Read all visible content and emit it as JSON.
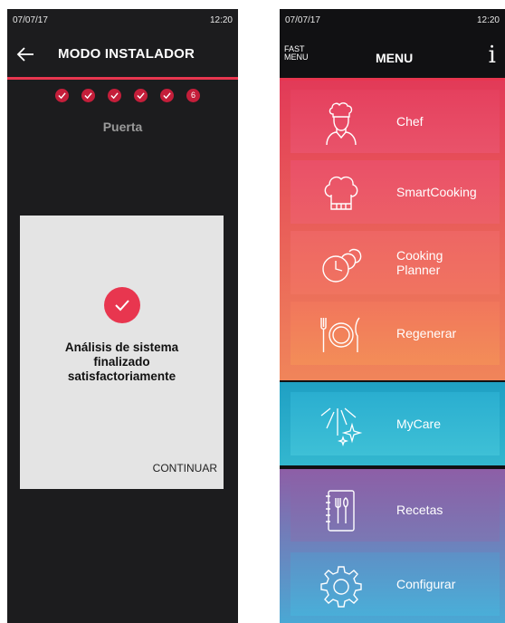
{
  "left": {
    "status": {
      "date": "07/07/17",
      "time": "12:20"
    },
    "header": {
      "title": "MODO INSTALADOR",
      "back_icon": "arrow-left-icon"
    },
    "steps": {
      "completed": 5,
      "current_label": "6"
    },
    "subtitle": "Puerta",
    "dialog": {
      "icon": "check-circle-icon",
      "message_lines": [
        "Análisis de sistema",
        "finalizado",
        "satisfactoriamente"
      ],
      "continue_label": "CONTINUAR"
    }
  },
  "right": {
    "status": {
      "date": "07/07/17",
      "time": "12:20"
    },
    "header": {
      "fast_menu_line1": "FAST",
      "fast_menu_line2": "MENU",
      "title": "MENU",
      "info_label": "i"
    },
    "items": [
      {
        "label": "Chef",
        "icon": "chef-icon"
      },
      {
        "label": "SmartCooking",
        "icon": "chef-hat-icon"
      },
      {
        "label_line1": "Cooking",
        "label_line2": "Planner",
        "icon": "clocks-icon"
      },
      {
        "label": "Regenerar",
        "icon": "plate-cutlery-icon"
      },
      {
        "label": "MyCare",
        "icon": "sparkle-clean-icon"
      },
      {
        "label": "Recetas",
        "icon": "recipe-book-icon"
      },
      {
        "label": "Configurar",
        "icon": "gear-icon"
      }
    ]
  },
  "colors": {
    "accent": "#e8364f",
    "background": "#1c1c1e",
    "dialog": "#e4e4e4"
  }
}
